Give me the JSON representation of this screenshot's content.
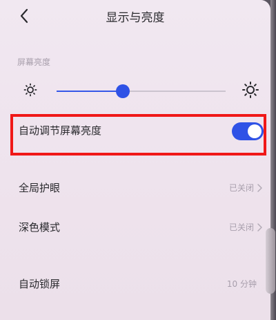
{
  "header": {
    "title": "显示与亮度",
    "back_icon": "chevron-left-icon"
  },
  "brightness": {
    "section_label": "屏幕亮度",
    "level": 0.39,
    "accent_color": "#2f52e6",
    "min_icon": "sun-small-icon",
    "max_icon": "sun-large-icon"
  },
  "auto_brightness": {
    "label": "自动调节屏幕亮度",
    "enabled": true
  },
  "rows": [
    {
      "label": "全局护眼",
      "value": "已关闭"
    },
    {
      "label": "深色模式",
      "value": "已关闭"
    },
    {
      "label": "自动锁屏",
      "value": "10 分钟"
    }
  ],
  "colors": {
    "highlight_border": "#f01818",
    "secondary_text": "#a89fac"
  }
}
